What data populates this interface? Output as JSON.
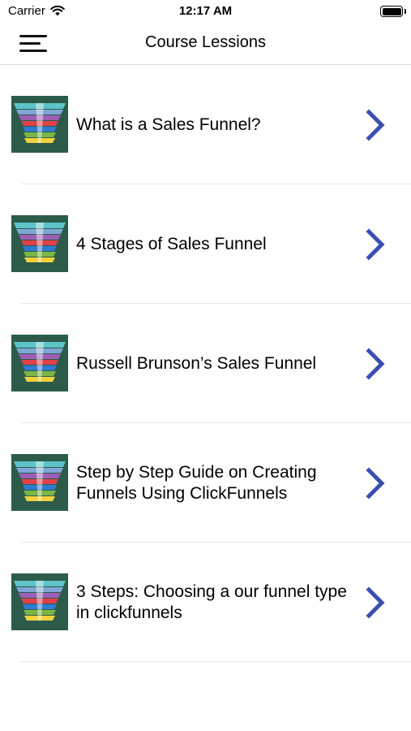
{
  "status_bar": {
    "carrier": "Carrier",
    "time": "12:17 AM",
    "icons": [
      "wifi-icon",
      "battery-icon"
    ]
  },
  "nav": {
    "title": "Course Lessions",
    "menu_icon": "hamburger-menu-icon"
  },
  "lessons": [
    {
      "title": "What is a Sales Funnel?"
    },
    {
      "title": "4 Stages of Sales Funnel"
    },
    {
      "title": "Russell Brunson’s Sales Funnel"
    },
    {
      "title": "Step by Step Guide on Creating Funnels Using ClickFunnels"
    },
    {
      "title": "3 Steps: Choosing a our funnel type in clickfunnels"
    }
  ],
  "colors": {
    "accent": "#3b4fb0",
    "thumb_bg": "#2c5b4a",
    "funnel": [
      "#5cc3c9",
      "#7fa7d6",
      "#9c5fb5",
      "#e0404a",
      "#2f7bd1",
      "#7ab648",
      "#f2d23e"
    ]
  }
}
